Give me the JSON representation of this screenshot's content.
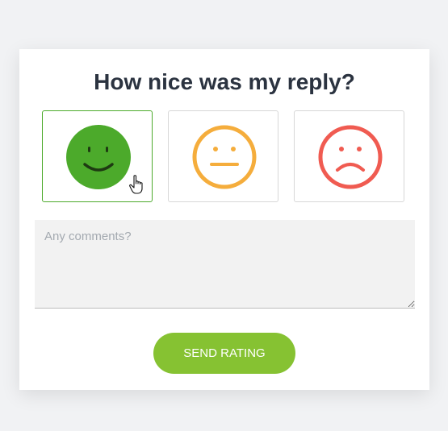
{
  "dialog": {
    "title": "How nice was my reply?"
  },
  "ratings": [
    {
      "name": "happy",
      "icon": "happy-face-icon",
      "color": "#4caa2b",
      "selected": true
    },
    {
      "name": "neutral",
      "icon": "neutral-face-icon",
      "color": "#f5ad3c",
      "selected": false
    },
    {
      "name": "sad",
      "icon": "sad-face-icon",
      "color": "#f05b51",
      "selected": false
    }
  ],
  "comments": {
    "placeholder": "Any comments?",
    "value": ""
  },
  "actions": {
    "send_label": "SEND RATING",
    "send_color": "#86c232"
  }
}
